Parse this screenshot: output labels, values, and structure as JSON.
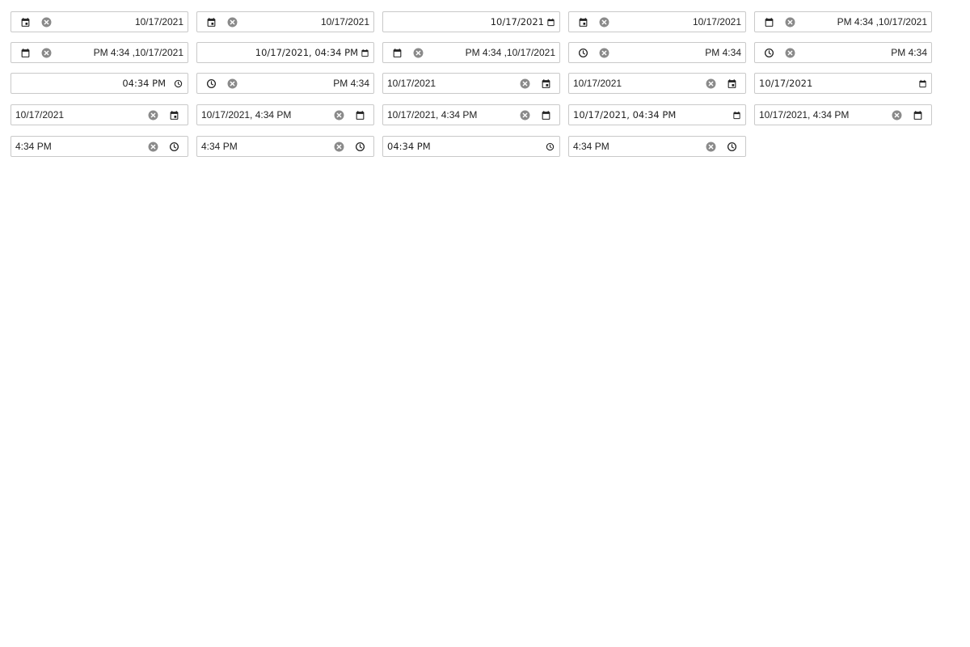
{
  "colors": {
    "border": "#c9c9c9",
    "icon": "#222222",
    "clear_icon": "#8a8a8a"
  },
  "rows": [
    [
      {
        "value": "10/17/2021",
        "dir": "rtl",
        "native": false,
        "icons": [
          "calendar-today-icon",
          "clear-icon"
        ],
        "name": "date-picker-rtl-1"
      },
      {
        "value": "10/17/2021",
        "dir": "rtl",
        "native": false,
        "icons": [
          "calendar-today-icon",
          "clear-icon"
        ],
        "name": "date-picker-rtl-2"
      },
      {
        "value": "10/17/2021",
        "dir": "rtl",
        "native": true,
        "icons": [],
        "trailing": "calendar-icon",
        "name": "native-date-input-rtl"
      },
      {
        "value": "10/17/2021",
        "dir": "rtl",
        "native": false,
        "icons": [
          "calendar-today-icon",
          "clear-icon"
        ],
        "name": "date-picker-rtl-3"
      },
      {
        "value": "PM 4:34 ,10/17/2021",
        "dir": "rtl",
        "native": false,
        "icons": [
          "calendar-icon",
          "clear-icon"
        ],
        "name": "datetime-picker-rtl-1"
      }
    ],
    [
      {
        "value": "PM 4:34 ,10/17/2021",
        "dir": "rtl",
        "native": false,
        "icons": [
          "calendar-icon",
          "clear-icon"
        ],
        "name": "datetime-picker-rtl-2"
      },
      {
        "value": "10/17/2021, 04:34 PM",
        "dir": "rtl",
        "native": true,
        "icons": [],
        "trailing": "calendar-icon",
        "name": "native-datetime-input-rtl"
      },
      {
        "value": "PM 4:34 ,10/17/2021",
        "dir": "rtl",
        "native": false,
        "icons": [
          "calendar-icon",
          "clear-icon"
        ],
        "name": "datetime-picker-rtl-3"
      },
      {
        "value": "PM 4:34",
        "dir": "rtl",
        "native": false,
        "icons": [
          "clock-icon",
          "clear-icon"
        ],
        "name": "time-picker-rtl-1"
      },
      {
        "value": "PM 4:34",
        "dir": "rtl",
        "native": false,
        "icons": [
          "clock-icon",
          "clear-icon"
        ],
        "name": "time-picker-rtl-2"
      }
    ],
    [
      {
        "value": "04:34 PM",
        "dir": "rtl",
        "native": true,
        "icons": [],
        "trailing": "clock-icon",
        "name": "native-time-input-rtl"
      },
      {
        "value": "PM 4:34",
        "dir": "rtl",
        "native": false,
        "icons": [
          "clock-icon",
          "clear-icon"
        ],
        "name": "time-picker-rtl-3"
      },
      {
        "value": "10/17/2021",
        "dir": "ltr",
        "native": false,
        "icons": [
          "clear-icon",
          "calendar-today-icon"
        ],
        "name": "date-picker-ltr-1"
      },
      {
        "value": "10/17/2021",
        "dir": "ltr",
        "native": false,
        "icons": [
          "clear-icon",
          "calendar-today-icon"
        ],
        "name": "date-picker-ltr-2"
      },
      {
        "value": "10/17/2021",
        "dir": "ltr",
        "native": true,
        "icons": [],
        "trailing": "calendar-icon",
        "name": "native-date-input-ltr"
      }
    ],
    [
      {
        "value": "10/17/2021",
        "dir": "ltr",
        "native": false,
        "icons": [
          "clear-icon",
          "calendar-today-icon"
        ],
        "name": "date-picker-ltr-3"
      },
      {
        "value": "10/17/2021, 4:34 PM",
        "dir": "ltr",
        "native": false,
        "icons": [
          "clear-icon",
          "calendar-icon"
        ],
        "name": "datetime-picker-ltr-1"
      },
      {
        "value": "10/17/2021, 4:34 PM",
        "dir": "ltr",
        "native": false,
        "icons": [
          "clear-icon",
          "calendar-icon"
        ],
        "name": "datetime-picker-ltr-2"
      },
      {
        "value": "10/17/2021, 04:34 PM",
        "dir": "ltr",
        "native": true,
        "icons": [],
        "trailing": "calendar-icon",
        "name": "native-datetime-input-ltr"
      },
      {
        "value": "10/17/2021, 4:34 PM",
        "dir": "ltr",
        "native": false,
        "icons": [
          "clear-icon",
          "calendar-icon"
        ],
        "name": "datetime-picker-ltr-3"
      }
    ],
    [
      {
        "value": "4:34 PM",
        "dir": "ltr",
        "native": false,
        "icons": [
          "clear-icon",
          "clock-icon"
        ],
        "name": "time-picker-ltr-1"
      },
      {
        "value": "4:34 PM",
        "dir": "ltr",
        "native": false,
        "icons": [
          "clear-icon",
          "clock-icon"
        ],
        "name": "time-picker-ltr-2"
      },
      {
        "value": "04:34 PM",
        "dir": "ltr",
        "native": true,
        "icons": [],
        "trailing": "clock-icon",
        "name": "native-time-input-ltr"
      },
      {
        "value": "4:34 PM",
        "dir": "ltr",
        "native": false,
        "icons": [
          "clear-icon",
          "clock-icon"
        ],
        "name": "time-picker-ltr-3"
      }
    ]
  ]
}
